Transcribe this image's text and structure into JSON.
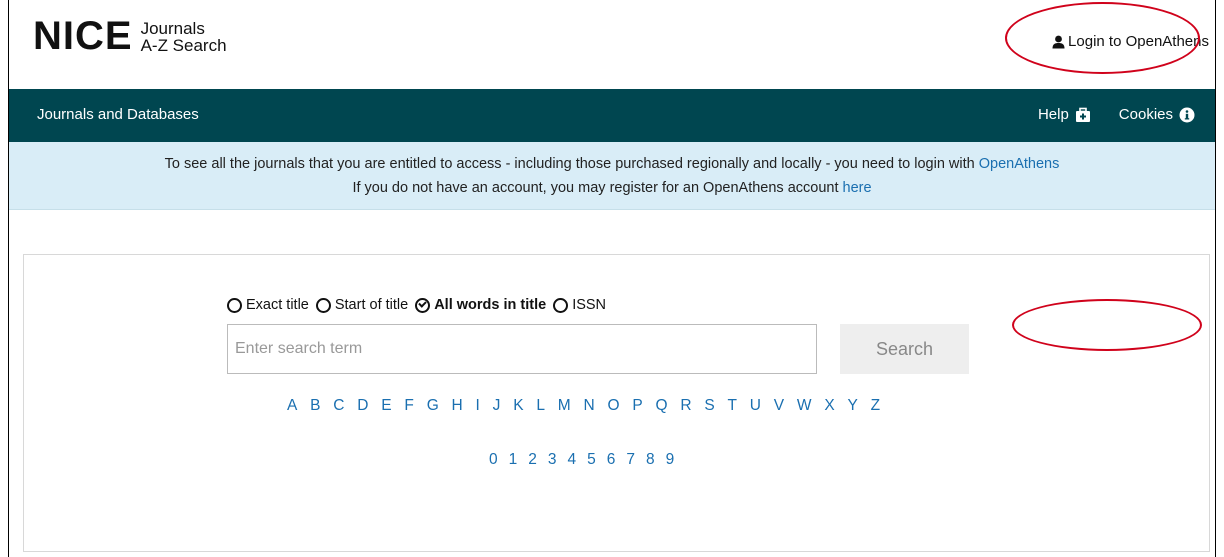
{
  "header": {
    "logo_text": "NICE",
    "subtitle_line1": "Journals",
    "subtitle_line2": "A-Z Search",
    "login_label": "Login to OpenAthens"
  },
  "nav": {
    "left_label": "Journals and Databases",
    "help_label": "Help",
    "cookies_label": "Cookies"
  },
  "notice": {
    "line1_text": "To see all the journals that you are entitled to access - including those purchased regionally and locally - you need to login with ",
    "line1_link": "OpenAthens",
    "line2_text": "If you do not have an account, you may register for an OpenAthens account ",
    "line2_link": "here"
  },
  "search": {
    "options": [
      {
        "label": "Exact title",
        "selected": false
      },
      {
        "label": "Start of title",
        "selected": false
      },
      {
        "label": "All words in title",
        "selected": true
      },
      {
        "label": "ISSN",
        "selected": false
      }
    ],
    "placeholder": "Enter search term",
    "button_label": "Search"
  },
  "letters": [
    "A",
    "B",
    "C",
    "D",
    "E",
    "F",
    "G",
    "H",
    "I",
    "J",
    "K",
    "L",
    "M",
    "N",
    "O",
    "P",
    "Q",
    "R",
    "S",
    "T",
    "U",
    "V",
    "W",
    "X",
    "Y",
    "Z"
  ],
  "digits": [
    "0",
    "1",
    "2",
    "3",
    "4",
    "5",
    "6",
    "7",
    "8",
    "9"
  ],
  "colors": {
    "nav_bg": "#004650",
    "notice_bg": "#d9edf7",
    "link": "#1a6fb0",
    "annotation": "#d0021b"
  },
  "icons": {
    "login": "user-icon",
    "help": "medkit-icon",
    "cookies": "info-circle-icon"
  }
}
